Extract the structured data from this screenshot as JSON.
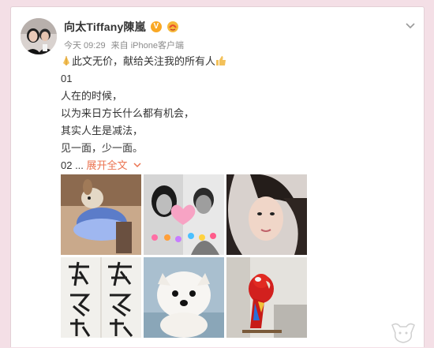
{
  "post": {
    "author_name": "向太Tiffany陳嵐",
    "verified_badge": "V",
    "time": "今天 09:29",
    "source": "来自 iPhone客户端",
    "lines": [
      "此文无价，献给关注我的所有人",
      "01",
      "人在的时候，",
      "以为来日方长什么都有机会，",
      "其实人生是减法，",
      "见一面，少一面。"
    ],
    "last_prefix": "02 ...",
    "expand_label": "展开全文",
    "images": [
      {
        "name": "dog-in-dress-photo",
        "desc": "dog"
      },
      {
        "name": "couple-hearts-photo",
        "desc": "couple"
      },
      {
        "name": "woman-portrait-photo",
        "desc": "woman"
      },
      {
        "name": "calligraphy-photo",
        "desc": "calligraphy"
      },
      {
        "name": "puppy-photo",
        "desc": "puppy"
      },
      {
        "name": "parrot-photo",
        "desc": "parrot"
      }
    ]
  },
  "colors": {
    "accent": "#eb7350",
    "page_bg": "#f4dfe6",
    "badge": "#f9a825"
  }
}
